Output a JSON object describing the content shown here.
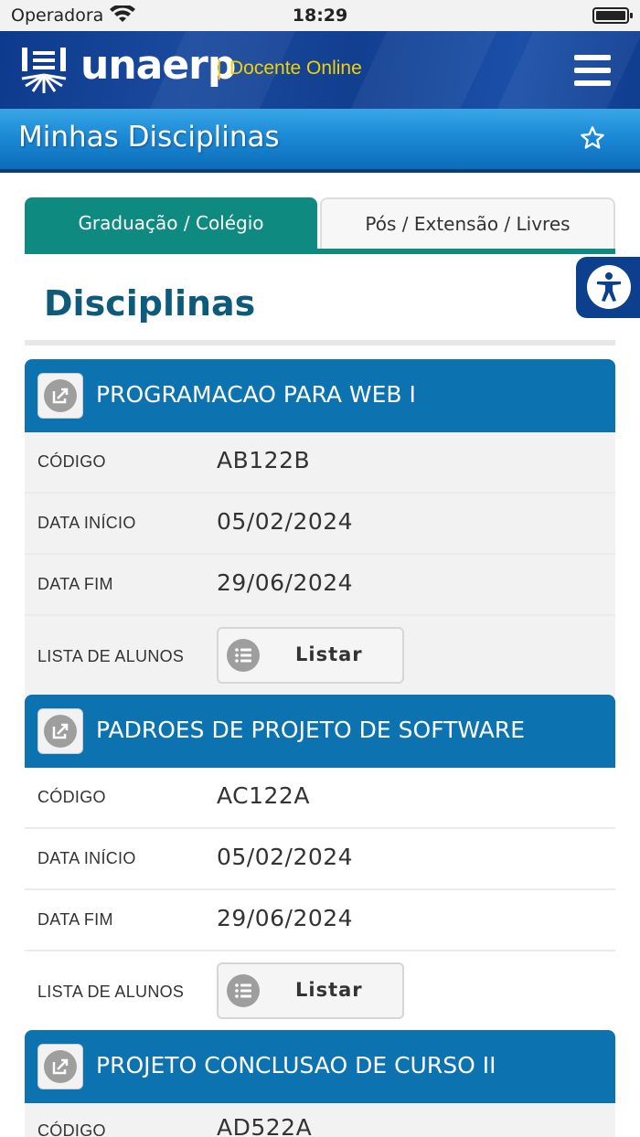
{
  "status_bar": {
    "carrier": "Operadora",
    "time": "18:29"
  },
  "header": {
    "brand": "unaerp",
    "separator": "|",
    "subtitle": "Docente Online"
  },
  "title_bar": {
    "title": "Minhas Disciplinas"
  },
  "tabs": [
    {
      "label": "Graduação / Colégio",
      "active": true
    },
    {
      "label": "Pós / Extensão / Livres",
      "active": false
    }
  ],
  "section": {
    "heading": "Disciplinas"
  },
  "labels": {
    "codigo": "CÓDIGO",
    "data_inicio": "DATA INÍCIO",
    "data_fim": "DATA FIM",
    "lista_alunos": "LISTA DE ALUNOS",
    "listar": "Listar"
  },
  "disciplinas": [
    {
      "nome": "PROGRAMACAO PARA WEB I",
      "codigo": "AB122B",
      "data_inicio": "05/02/2024",
      "data_fim": "29/06/2024"
    },
    {
      "nome": "PADROES DE PROJETO DE SOFTWARE",
      "codigo": "AC122A",
      "data_inicio": "05/02/2024",
      "data_fim": "29/06/2024"
    },
    {
      "nome": "PROJETO CONCLUSAO DE CURSO II",
      "codigo": "AD522A"
    }
  ],
  "colors": {
    "header_bg": "#123f90",
    "title_bar_bg": "#1c8ad6",
    "tab_active": "#0e8a80",
    "card_header": "#0d72b0",
    "logo_subtitle": "#f5d000",
    "accessibility_bg": "#0c3f8e"
  },
  "icons": {
    "wifi": "wifi-icon",
    "battery": "battery-icon",
    "menu": "hamburger-menu-icon",
    "favorite": "star-icon",
    "accessibility": "accessibility-icon",
    "open": "open-external-icon",
    "list": "list-icon"
  }
}
